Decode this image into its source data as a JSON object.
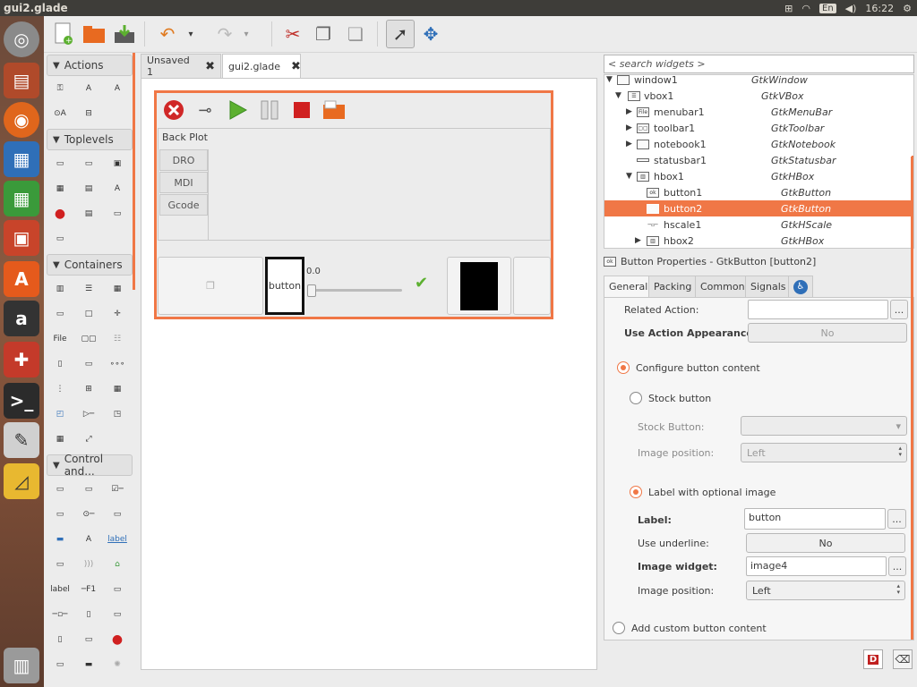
{
  "topbar": {
    "title": "gui2.glade",
    "lang": "En",
    "time": "16:22"
  },
  "launcher": {
    "items": [
      "ubuntu-icon",
      "files-icon",
      "firefox-icon",
      "writer-icon",
      "calc-icon",
      "impress-icon",
      "software-center-icon",
      "amazon-icon",
      "settings-icon",
      "terminal-icon",
      "text-editor-icon",
      "glade-icon",
      "trash-icon"
    ]
  },
  "palette": {
    "groups": [
      "Actions",
      "Toplevels",
      "Containers",
      "Control and..."
    ],
    "label_icon_text": "label",
    "file_icon_text": "File"
  },
  "tabs": [
    {
      "label": "Unsaved 1",
      "close": "✖"
    },
    {
      "label": "gui2.glade",
      "close": "✖"
    }
  ],
  "design": {
    "notebook_tabs": [
      "Back Plot",
      "DRO",
      "MDI",
      "Gcode"
    ],
    "hbox_button_label": "button",
    "scale_value": "0.0"
  },
  "inspector": {
    "search_placeholder": "< search widgets >",
    "rows": [
      {
        "name": "window1",
        "class": "GtkWindow"
      },
      {
        "name": "vbox1",
        "class": "GtkVBox"
      },
      {
        "name": "menubar1",
        "class": "GtkMenuBar"
      },
      {
        "name": "toolbar1",
        "class": "GtkToolbar"
      },
      {
        "name": "notebook1",
        "class": "GtkNotebook"
      },
      {
        "name": "statusbar1",
        "class": "GtkStatusbar"
      },
      {
        "name": "hbox1",
        "class": "GtkHBox"
      },
      {
        "name": "button1",
        "class": "GtkButton"
      },
      {
        "name": "button2",
        "class": "GtkButton"
      },
      {
        "name": "hscale1",
        "class": "GtkHScale"
      },
      {
        "name": "hbox2",
        "class": "GtkHBox"
      }
    ]
  },
  "properties": {
    "header": "Button Properties - GtkButton [button2]",
    "tabs": [
      "General",
      "Packing",
      "Common",
      "Signals"
    ],
    "related_action_label": "Related Action:",
    "use_action_appearance_label": "Use Action Appearance:",
    "use_action_appearance_value": "No",
    "configure_content": "Configure button content",
    "stock_button_radio": "Stock button",
    "stock_button_label": "Stock Button:",
    "image_position_label": "Image position:",
    "image_position_disabled": "Left",
    "label_optional_image": "Label with optional image",
    "label_label": "Label:",
    "label_value": "button",
    "use_underline_label": "Use underline:",
    "use_underline_value": "No",
    "image_widget_label": "Image widget:",
    "image_widget_value": "image4",
    "image_position_value": "Left",
    "add_custom": "Add custom button content",
    "ellipsis": "..."
  }
}
